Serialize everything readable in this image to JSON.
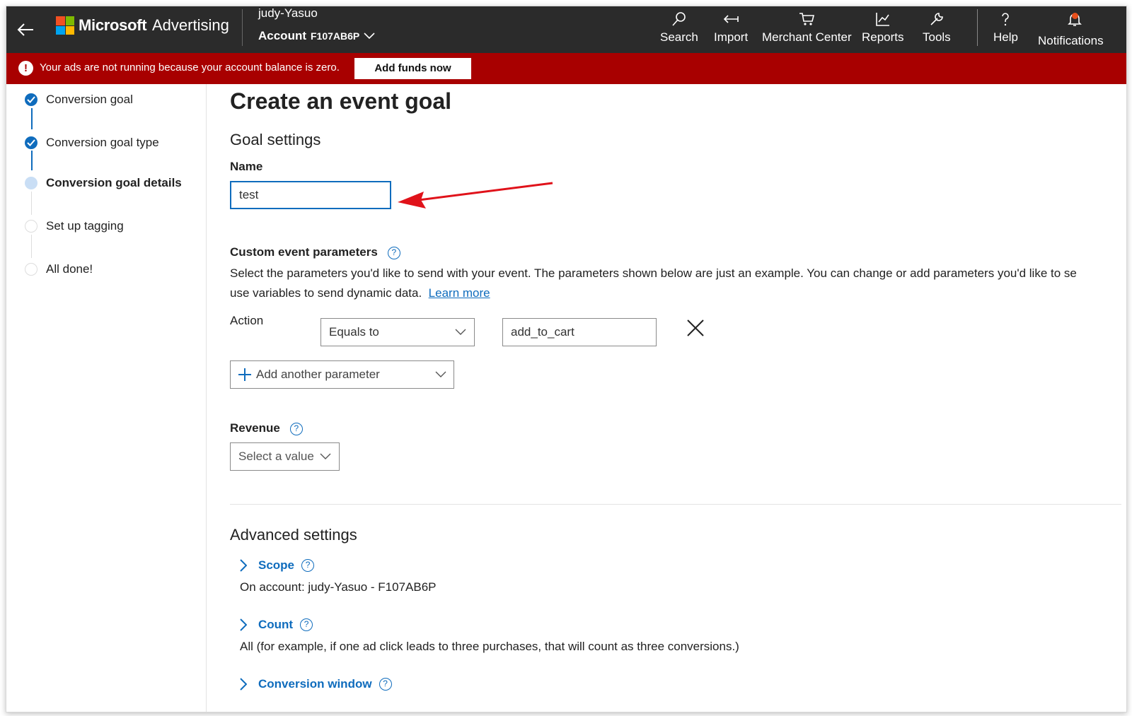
{
  "topbar": {
    "brand_name": "Microsoft",
    "brand_product": "Advertising",
    "account_user": "judy-Yasuo",
    "account_label": "Account",
    "account_id": "F107AB6P",
    "nav": [
      {
        "label": "Search",
        "icon": "search-icon"
      },
      {
        "label": "Import",
        "icon": "import-icon"
      },
      {
        "label": "Merchant Center",
        "icon": "cart-icon"
      },
      {
        "label": "Reports",
        "icon": "chart-icon"
      },
      {
        "label": "Tools",
        "icon": "wrench-icon"
      },
      {
        "label": "Help",
        "icon": "question-icon"
      },
      {
        "label": "Notifications",
        "icon": "bell-icon"
      }
    ]
  },
  "banner": {
    "message": "Your ads are not running because your account balance is zero.",
    "button": "Add funds now",
    "color": "#a80000"
  },
  "steps": [
    {
      "label": "Conversion goal",
      "state": "done"
    },
    {
      "label": "Conversion goal type",
      "state": "done"
    },
    {
      "label": "Conversion goal details",
      "state": "active"
    },
    {
      "label": "Set up tagging",
      "state": "todo"
    },
    {
      "label": "All done!",
      "state": "todo"
    }
  ],
  "main": {
    "title": "Create an event goal",
    "section": "Goal settings",
    "name_label": "Name",
    "name_value": "test",
    "custom_params_label": "Custom event parameters",
    "custom_params_desc_line1": "Select the parameters you'd like to send with your event. The parameters shown below are just an example. You can change or add parameters you'd like to se",
    "custom_params_desc_line2": "use variables to send dynamic data.",
    "learn_more": "Learn more",
    "action_label": "Action",
    "action_operator": "Equals to",
    "action_value": "add_to_cart",
    "add_param": "Add another parameter",
    "revenue_label": "Revenue",
    "revenue_select": "Select a value",
    "advanced_title": "Advanced settings",
    "scope_label": "Scope",
    "scope_value": "On account: judy-Yasuo - F107AB6P",
    "count_label": "Count",
    "count_value": "All (for example, if one ad click leads to three purchases, that will count as three conversions.)",
    "window_label": "Conversion window"
  },
  "colors": {
    "accent": "#0f6cbd",
    "topbar": "#2b2b2b",
    "annotation_arrow": "#e0121a"
  }
}
